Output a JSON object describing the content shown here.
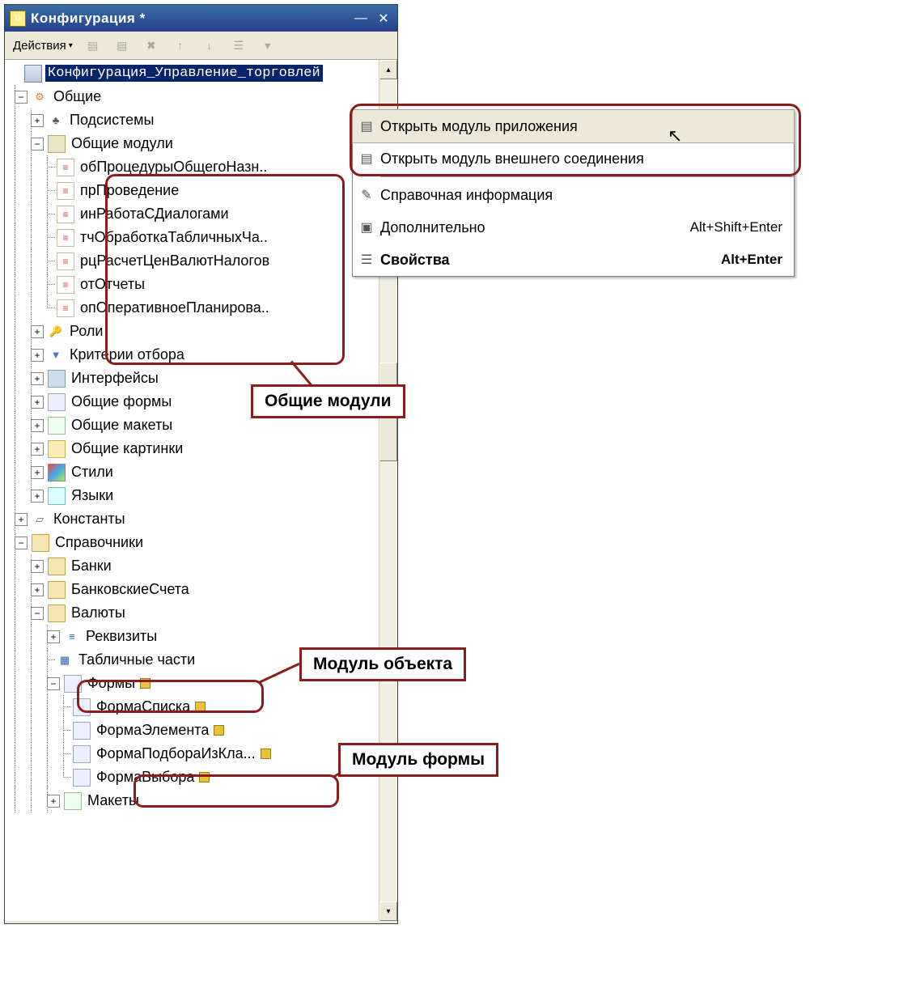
{
  "window": {
    "title": "Конфигурация *"
  },
  "toolbar": {
    "actions": "Действия"
  },
  "tree": {
    "root": "Конфигурация_Управление_торговлей",
    "common": "Общие",
    "subsystems": "Подсистемы",
    "commonModules": "Общие модули",
    "mods": {
      "m1": "обПроцедурыОбщегоНазн..",
      "m2": "прПроведение",
      "m3": "инРаботаСДиалогами",
      "m4": "тчОбработкаТабличныхЧа..",
      "m5": "рцРасчетЦенВалютНалогов",
      "m6": "отОтчеты",
      "m7": "опОперативноеПланирова.."
    },
    "roles": "Роли",
    "criteria": "Критерии отбора",
    "interfaces": "Интерфейсы",
    "commonForms": "Общие формы",
    "commonTemplates": "Общие макеты",
    "commonPictures": "Общие картинки",
    "styles": "Стили",
    "languages": "Языки",
    "constants": "Константы",
    "catalogs": "Справочники",
    "banks": "Банки",
    "bankAccounts": "БанковскиеСчета",
    "currencies": "Валюты",
    "attributes": "Реквизиты",
    "tabularSections": "Табличные части",
    "forms": "Формы",
    "f1": "ФормаСписка",
    "f2": "ФормаЭлемента",
    "f3": "ФормаПодбораИзКла...",
    "f4": "ФормаВыбора",
    "templates": "Макеты"
  },
  "context": {
    "openAppModule": "Открыть модуль приложения",
    "openExtModule": "Открыть модуль внешнего соединения",
    "helpInfo": "Справочная информация",
    "additional": "Дополнительно",
    "additionalSc": "Alt+Shift+Enter",
    "properties": "Свойства",
    "propertiesSc": "Alt+Enter"
  },
  "tags": {
    "commonModules": "Общие модули",
    "objectModule": "Модуль объекта",
    "formModule": "Модуль формы"
  }
}
